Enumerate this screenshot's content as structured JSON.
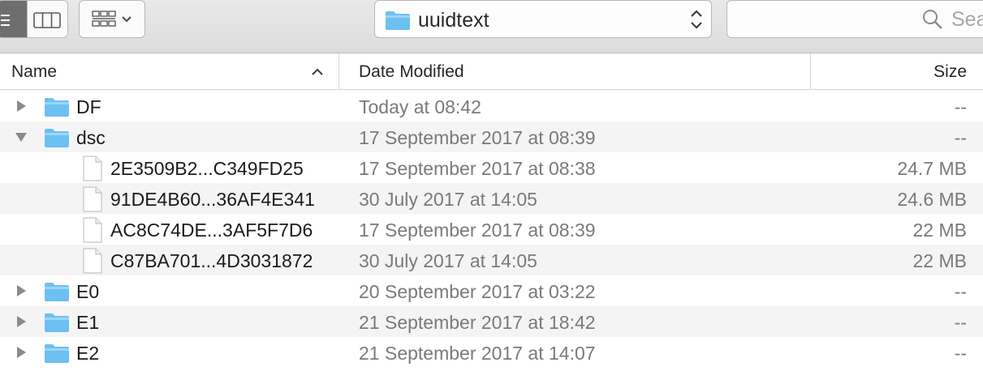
{
  "toolbar": {
    "path_popup": {
      "label": "uuidtext",
      "icon": "folder-icon"
    },
    "search": {
      "placeholder": "Search"
    }
  },
  "columns": {
    "name": "Name",
    "date_modified": "Date Modified",
    "size": "Size",
    "sort": "ascending"
  },
  "rows": [
    {
      "name": "DF",
      "date": "Today at 08:42",
      "size": "--",
      "kind": "folder",
      "expanded": false
    },
    {
      "name": "dsc",
      "date": "17 September 2017 at 08:39",
      "size": "--",
      "kind": "folder",
      "expanded": true
    },
    {
      "name": "2E3509B2...C349FD25",
      "date": "17 September 2017 at 08:38",
      "size": "24.7 MB",
      "kind": "file"
    },
    {
      "name": "91DE4B60...36AF4E341",
      "date": "30 July 2017 at 14:05",
      "size": "24.6 MB",
      "kind": "file"
    },
    {
      "name": "AC8C74DE...3AF5F7D6",
      "date": "17 September 2017 at 08:39",
      "size": "22 MB",
      "kind": "file"
    },
    {
      "name": "C87BA701...4D3031872",
      "date": "30 July 2017 at 14:05",
      "size": "22 MB",
      "kind": "file"
    },
    {
      "name": "E0",
      "date": "20 September 2017 at 03:22",
      "size": "--",
      "kind": "folder",
      "expanded": false
    },
    {
      "name": "E1",
      "date": "21 September 2017 at 18:42",
      "size": "--",
      "kind": "folder",
      "expanded": false
    },
    {
      "name": "E2",
      "date": "21 September 2017 at 14:07",
      "size": "--",
      "kind": "folder",
      "expanded": false
    }
  ],
  "colors": {
    "folder": "#6cc0f2",
    "folder_tab": "#9dd5f6",
    "alt_row": "#f4f4f4",
    "secondary_text": "#7a7a7a"
  }
}
